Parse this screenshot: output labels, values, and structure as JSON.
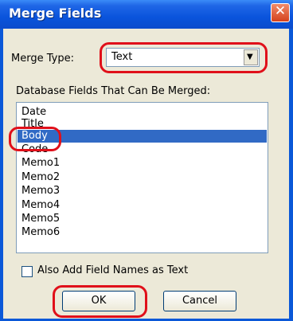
{
  "window": {
    "title": "Merge Fields",
    "close_glyph": "✕"
  },
  "merge_type": {
    "label": "Merge Type:",
    "selected": "Text",
    "dropdown_glyph": "▼"
  },
  "fields": {
    "label": "Database Fields That Can Be Merged:",
    "items": [
      "Date",
      "Title",
      "Body",
      "Code",
      "Memo1",
      "Memo2",
      "Memo3",
      "Memo4",
      "Memo5",
      "Memo6"
    ],
    "selected_item": "Body"
  },
  "also_add": {
    "label": "Also Add Field Names as Text",
    "checked": false
  },
  "buttons": {
    "ok": "OK",
    "cancel": "Cancel"
  },
  "colors": {
    "titlebar": "#0a54dc",
    "selection": "#316ac5",
    "highlight_annotation": "#e0101a",
    "dialog_bg": "#ece9d8"
  }
}
